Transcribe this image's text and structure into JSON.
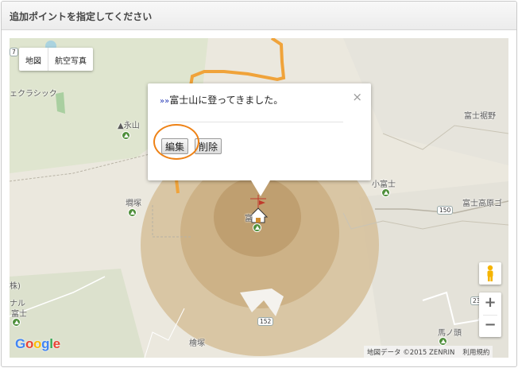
{
  "header": {
    "title": "追加ポイントを指定してください"
  },
  "map_type": {
    "map": "地図",
    "satellite": "航空写真"
  },
  "info_window": {
    "message": "富士山に登ってきました。",
    "arrow_glyph": "»",
    "close_glyph": "×",
    "edit_label": "編集",
    "delete_label": "削除"
  },
  "places": {
    "classic": "ェクラシック",
    "eiyama": "▲永山",
    "kasatsuka": "墹塚",
    "fuji_susono": "富士裾野",
    "kofuji": "小富士",
    "fuji_kogen": "富士高原ゴ",
    "fuji_summit": "富",
    "umanokubi": "馬ノ頭",
    "hinokizuka": "檜塚",
    "left_ru": "ナル",
    "left_fuji": "富士",
    "left_shu": "株)",
    "route_150": "150",
    "route_152": "152",
    "route_23": "23",
    "route_7": "7"
  },
  "google_logo": [
    "G",
    "o",
    "o",
    "g",
    "l",
    "e"
  ],
  "google_colors": [
    "#4285F4",
    "#EA4335",
    "#FBBC05",
    "#4285F4",
    "#34A853",
    "#EA4335"
  ],
  "attribution": {
    "data": "地図データ ©2015 ZENRIN",
    "terms": "利用規約"
  },
  "zoom": {
    "in": "+",
    "out": "−"
  },
  "colors": {
    "annotation": "#ee8216",
    "road_orange": "#f0a33a",
    "mountain": "#c7a77a"
  }
}
